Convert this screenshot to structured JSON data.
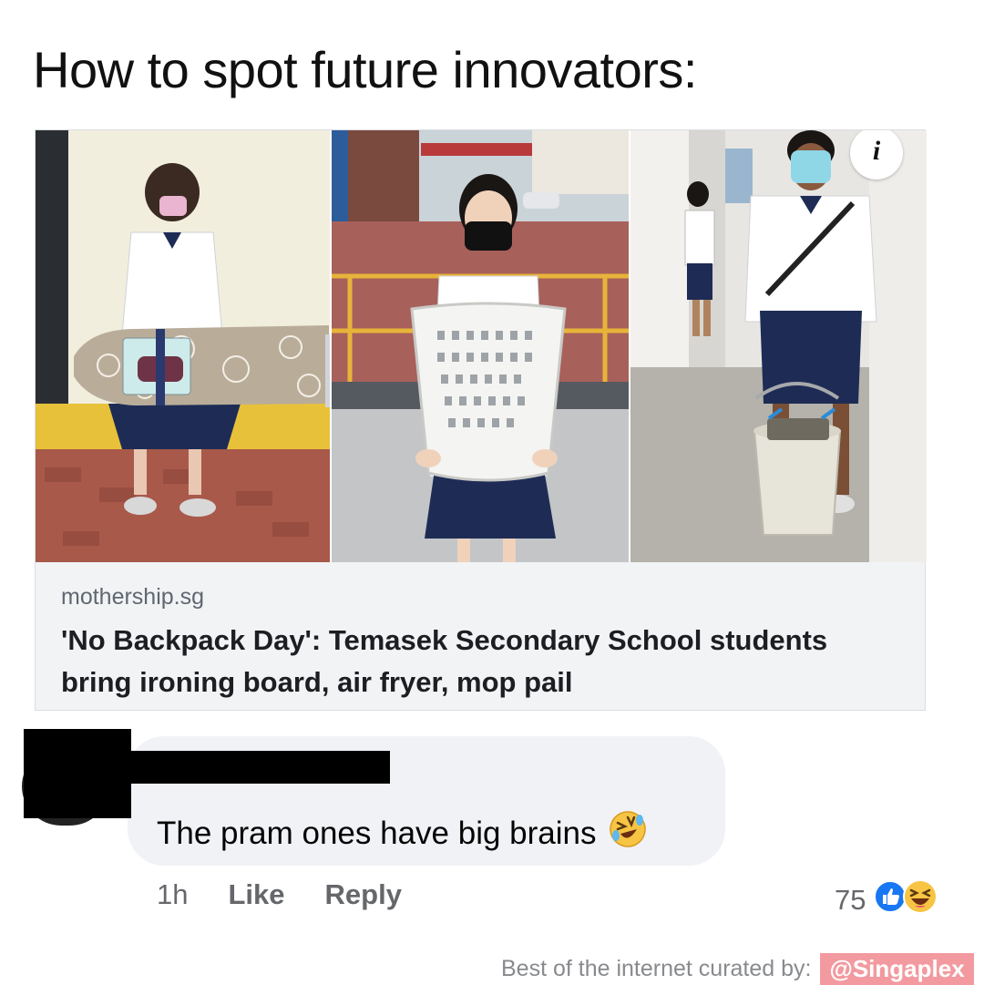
{
  "meme": {
    "title": "How to spot future innovators:"
  },
  "link_preview": {
    "domain": "mothership.sg",
    "headline": "'No Backpack Day': Temasek Secondary School students bring ironing board, air fryer, mop pail",
    "info_icon": "i",
    "photos": [
      {
        "subject": "student holding ironing board",
        "icon": "ironing-board"
      },
      {
        "subject": "student holding laundry basket",
        "icon": "laundry-basket"
      },
      {
        "subject": "student holding mop pail",
        "icon": "mop-pail"
      }
    ]
  },
  "comment": {
    "text": "The pram ones have big brains",
    "emoji": "rolling-on-floor-laughing-emoji",
    "time": "1h",
    "like_label": "Like",
    "reply_label": "Reply",
    "reaction_count": "75",
    "reactions": [
      "like-reaction-icon",
      "haha-reaction-icon"
    ]
  },
  "watermark": {
    "label": "Best of the internet curated by:",
    "handle": "@Singaplex"
  },
  "colors": {
    "facebook_blue": "#1877f2",
    "bubble_gray": "#f0f2f5",
    "meta_gray": "#65676b",
    "watermark_pink": "#f29aa0"
  }
}
